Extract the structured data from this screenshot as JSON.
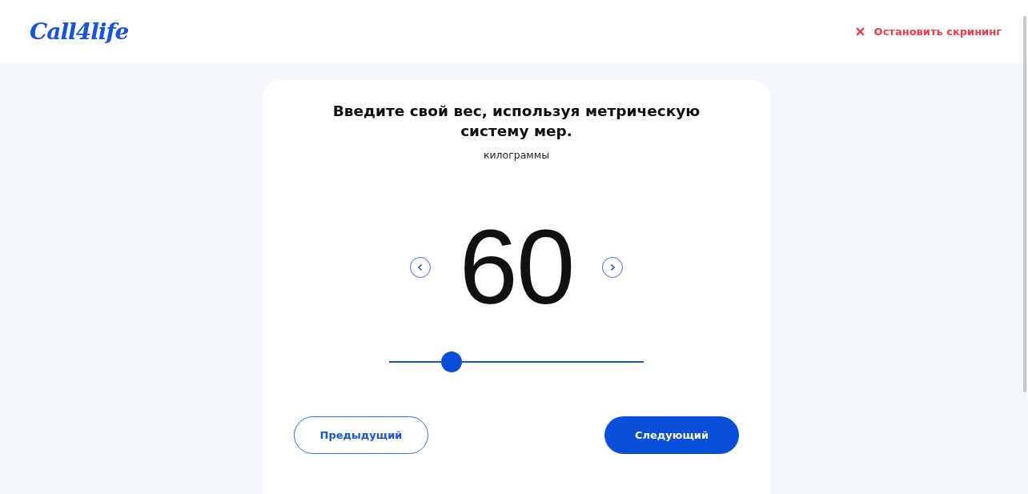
{
  "header": {
    "logo": "Call4life",
    "stop_link": "Остановить скрининг"
  },
  "question": {
    "title": "Введите свой вес, используя метрическую систему мер.",
    "unit": "килограммы",
    "value": "60",
    "slider": {
      "level": 0.245
    }
  },
  "buttons": [
    {
      "label": "Предыдущий",
      "kind": "secondary"
    },
    {
      "label": "Следующий",
      "kind": "primary"
    }
  ]
}
